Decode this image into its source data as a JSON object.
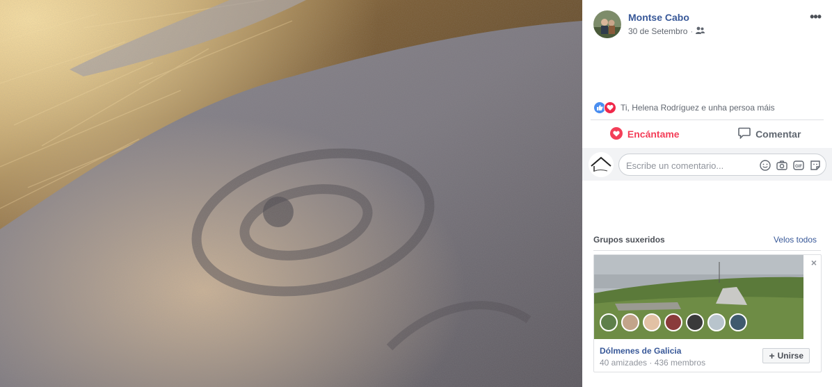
{
  "post": {
    "author": "Montse Cabo",
    "date": "30 de Setembro",
    "reactions_text": "Ti, Helena Rodríguez e unha persoa máis",
    "actions": {
      "love_label": "Encántame",
      "comment_label": "Comentar"
    },
    "comment_placeholder": "Escribe un comentario..."
  },
  "suggested": {
    "title": "Grupos suxeridos",
    "see_all": "Velos todos",
    "group": {
      "name": "Dólmenes de Galicia",
      "meta": "40 amizades · 436 membros",
      "join_label": "Unirse",
      "close": "×"
    }
  },
  "colors": {
    "link": "#385898",
    "love": "#f33e58",
    "like": "#4a8ef0"
  },
  "icons": [
    "friends-icon",
    "more-options-icon",
    "like-reaction-icon",
    "love-reaction-icon",
    "heart-icon",
    "comment-icon",
    "emoji-icon",
    "camera-icon",
    "gif-icon",
    "sticker-icon",
    "plus-icon",
    "close-icon"
  ]
}
